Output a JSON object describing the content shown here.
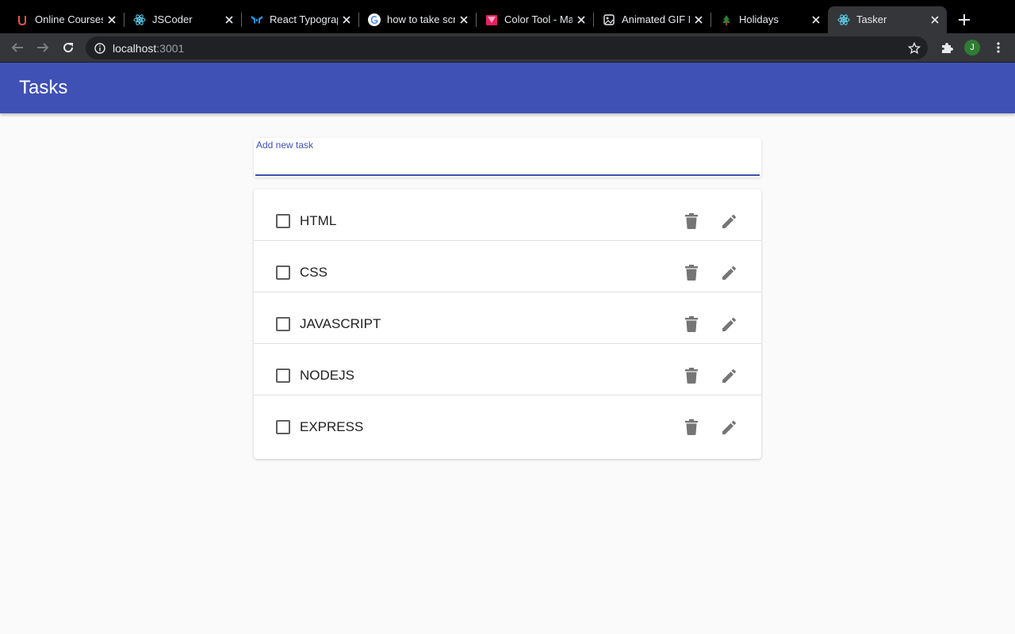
{
  "browser": {
    "tabs": [
      {
        "title": "Online Courses",
        "icon": "udemy-icon",
        "active": false
      },
      {
        "title": "JSCoder",
        "icon": "react-icon",
        "active": false
      },
      {
        "title": "React Typography",
        "icon": "mui-icon",
        "active": false
      },
      {
        "title": "how to take screenshot",
        "icon": "google-icon",
        "active": false
      },
      {
        "title": "Color Tool - Material",
        "icon": "color-tool-icon",
        "active": false
      },
      {
        "title": "Animated GIF Maker",
        "icon": "gif-icon",
        "active": false
      },
      {
        "title": "Holidays",
        "icon": "holidays-icon",
        "active": false
      },
      {
        "title": "Tasker",
        "icon": "react-icon",
        "active": true
      }
    ],
    "url_host": "localhost",
    "url_port": ":3001",
    "profile_initial": "J"
  },
  "app": {
    "title": "Tasks",
    "accent_color": "#3f51b5"
  },
  "add_task": {
    "label": "Add new task",
    "value": ""
  },
  "tasks": [
    {
      "label": "HTML",
      "checked": false
    },
    {
      "label": "CSS",
      "checked": false
    },
    {
      "label": "JAVASCRIPT",
      "checked": false
    },
    {
      "label": "NODEJS",
      "checked": false
    },
    {
      "label": "EXPRESS",
      "checked": false
    }
  ],
  "icons": {
    "delete": "delete-icon",
    "edit": "edit-icon"
  }
}
